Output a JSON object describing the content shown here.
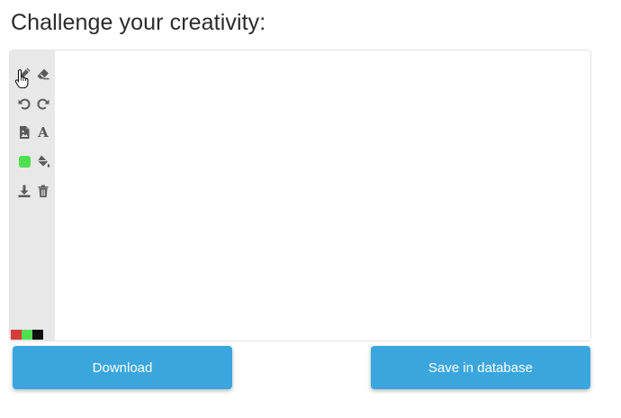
{
  "heading": "Challenge your creativity:",
  "toolbar": {
    "tools": [
      {
        "name": "pencil-icon",
        "label": "Pencil"
      },
      {
        "name": "eraser-icon",
        "label": "Eraser"
      },
      {
        "name": "undo-icon",
        "label": "Undo"
      },
      {
        "name": "redo-icon",
        "label": "Redo"
      },
      {
        "name": "image-icon",
        "label": "Insert image"
      },
      {
        "name": "font-icon",
        "label": "A"
      },
      {
        "name": "color-picker-icon",
        "label": "Color"
      },
      {
        "name": "fill-bucket-icon",
        "label": "Fill"
      },
      {
        "name": "download-icon",
        "label": "Download"
      },
      {
        "name": "trash-icon",
        "label": "Clear"
      }
    ],
    "active_color": "#4ee04e",
    "icon_color": "#5a5a5a"
  },
  "palette": [
    "#d83a3a",
    "#4ee04e",
    "#111111"
  ],
  "buttons": {
    "download_label": "Download",
    "save_label": "Save in database"
  },
  "colors": {
    "button_bg": "#3ba6dd",
    "toolbar_bg": "#e8e8e8"
  }
}
